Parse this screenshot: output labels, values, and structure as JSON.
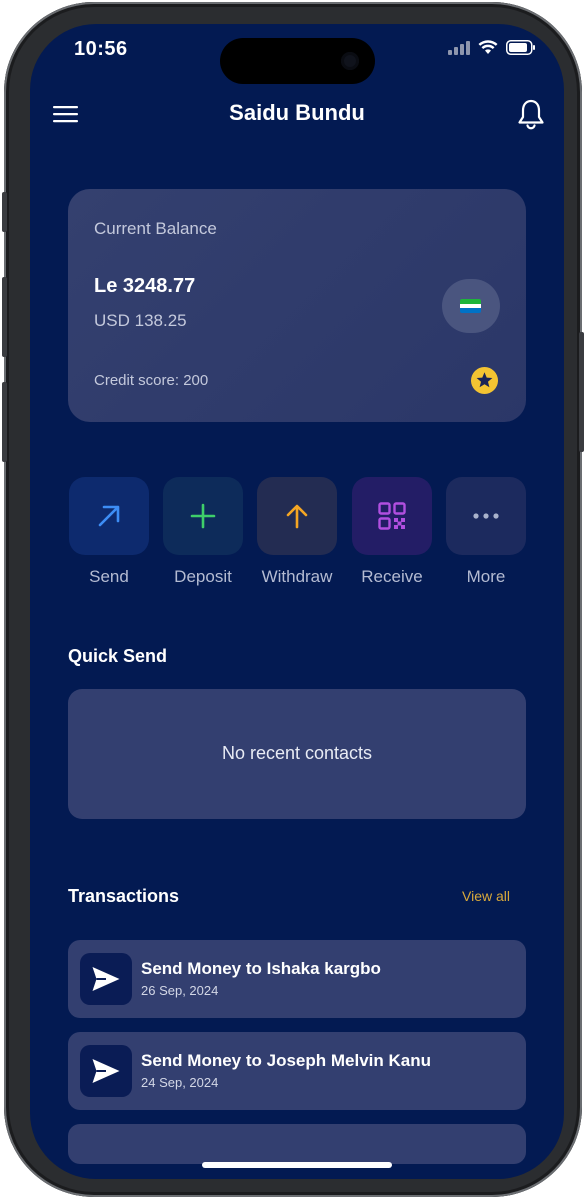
{
  "status_bar": {
    "time": "10:56",
    "icons": [
      "signal-icon",
      "wifi-icon",
      "battery-icon"
    ]
  },
  "header": {
    "title": "Saidu Bundu",
    "menu_icon": "hamburger-menu-icon",
    "notification_icon": "bell-icon"
  },
  "balance_card": {
    "label": "Current Balance",
    "amount": "Le 3248.77",
    "usd_amount": "USD 138.25",
    "credit_score": "Credit score: 200",
    "currency_flag_icon": "sierra-leone-flag-icon",
    "badge_icon": "star-icon"
  },
  "actions": [
    {
      "label": "Send",
      "icon": "arrow-up-right-icon",
      "color": "#3d8df5",
      "tile": "#0d2a6e"
    },
    {
      "label": "Deposit",
      "icon": "plus-icon",
      "color": "#3ecf6a",
      "tile": "#0d2b5a"
    },
    {
      "label": "Withdraw",
      "icon": "arrow-up-icon",
      "color": "#f5a623",
      "tile": "#232c52"
    },
    {
      "label": "Receive",
      "icon": "qr-code-icon",
      "color": "#b14fe0",
      "tile": "#231d66"
    },
    {
      "label": "More",
      "icon": "more-dots-icon",
      "color": "#aab3cc",
      "tile": "#1c2a5e"
    }
  ],
  "quick_send": {
    "title": "Quick Send",
    "empty_text": "No recent contacts"
  },
  "transactions": {
    "title": "Transactions",
    "view_all": "View all",
    "items": [
      {
        "title": "Send Money to Ishaka kargbo",
        "date": "26 Sep, 2024",
        "icon": "paper-plane-icon"
      },
      {
        "title": "Send Money to Joseph Melvin Kanu",
        "date": "24 Sep, 2024",
        "icon": "paper-plane-icon"
      }
    ]
  },
  "colors": {
    "background": "#031a52",
    "card": "#333f70",
    "accent_gold": "#d9a93b",
    "star": "#f3c332"
  }
}
